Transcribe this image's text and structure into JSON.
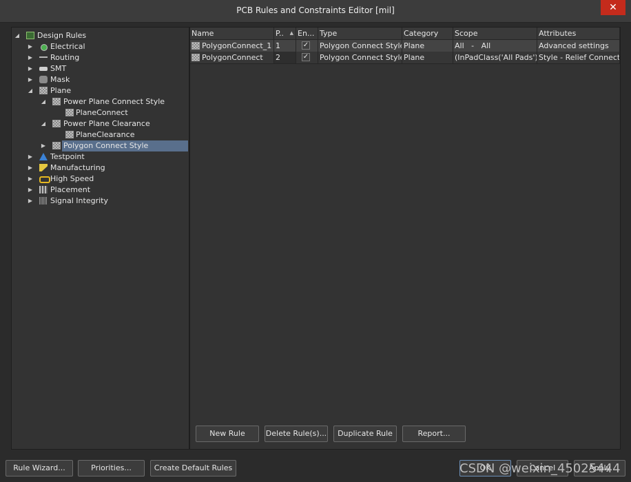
{
  "window": {
    "title": "PCB Rules and Constraints Editor [mil]",
    "close_glyph": "✕"
  },
  "tree": {
    "root": "Design Rules",
    "items": [
      {
        "label": "Electrical",
        "icon": "electrical-icon"
      },
      {
        "label": "Routing",
        "icon": "routing-icon"
      },
      {
        "label": "SMT",
        "icon": "smt-icon"
      },
      {
        "label": "Mask",
        "icon": "mask-icon"
      },
      {
        "label": "Plane",
        "icon": "plane-icon"
      },
      {
        "label": "Power Plane Connect Style",
        "icon": "rule-category-icon"
      },
      {
        "label": "PlaneConnect",
        "icon": "rule-icon"
      },
      {
        "label": "Power Plane Clearance",
        "icon": "rule-category-icon"
      },
      {
        "label": "PlaneClearance",
        "icon": "rule-icon"
      },
      {
        "label": "Polygon Connect Style",
        "icon": "rule-category-icon"
      },
      {
        "label": "Testpoint",
        "icon": "testpoint-icon"
      },
      {
        "label": "Manufacturing",
        "icon": "manufacturing-icon"
      },
      {
        "label": "High Speed",
        "icon": "high-speed-icon"
      },
      {
        "label": "Placement",
        "icon": "placement-icon"
      },
      {
        "label": "Signal Integrity",
        "icon": "signal-integrity-icon"
      }
    ],
    "expand_glyph": "◢",
    "collapse_glyph": "▶"
  },
  "grid": {
    "columns": [
      "Name",
      "P..",
      "En...",
      "Type",
      "Category",
      "Scope",
      "Attributes"
    ],
    "sort_glyph": "▲",
    "rows": [
      {
        "name": "PolygonConnect_1",
        "priority": "1",
        "enabled": "✓",
        "type": "Polygon Connect Style",
        "category": "Plane",
        "scope": "All   -   All",
        "attributes": "Advanced settings"
      },
      {
        "name": "PolygonConnect",
        "priority": "2",
        "enabled": "✓",
        "type": "Polygon Connect Style",
        "category": "Plane",
        "scope": "(InPadClass('All Pads'))",
        "attributes": "Style - Relief Connect"
      }
    ]
  },
  "grid_buttons": {
    "new_rule": "New Rule",
    "delete_rules": "Delete Rule(s)...",
    "duplicate_rule": "Duplicate Rule",
    "report": "Report..."
  },
  "footer_buttons": {
    "rule_wizard": "Rule Wizard...",
    "priorities": "Priorities...",
    "create_default": "Create Default Rules",
    "ok": "OK",
    "cancel": "Cancel",
    "apply": "Apply"
  },
  "watermark": "CSDN @weixin_45025444"
}
